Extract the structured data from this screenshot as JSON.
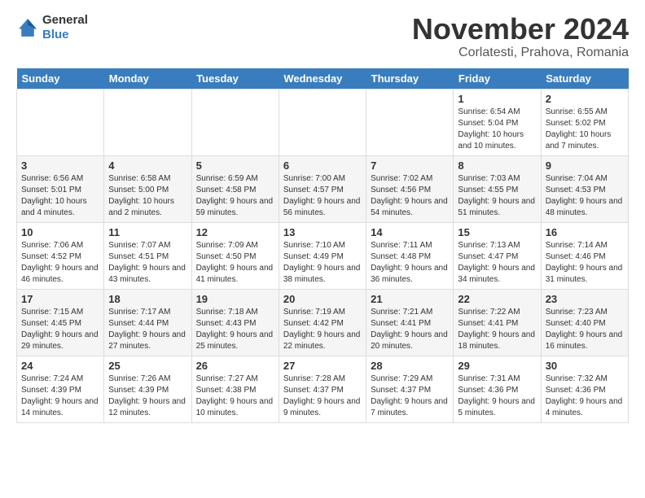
{
  "header": {
    "logo_general": "General",
    "logo_blue": "Blue",
    "title": "November 2024",
    "location": "Corlatesti, Prahova, Romania"
  },
  "days_of_week": [
    "Sunday",
    "Monday",
    "Tuesday",
    "Wednesday",
    "Thursday",
    "Friday",
    "Saturday"
  ],
  "weeks": [
    [
      null,
      null,
      null,
      null,
      null,
      {
        "day": "1",
        "info": "Sunrise: 6:54 AM\nSunset: 5:04 PM\nDaylight: 10 hours and 10 minutes."
      },
      {
        "day": "2",
        "info": "Sunrise: 6:55 AM\nSunset: 5:02 PM\nDaylight: 10 hours and 7 minutes."
      }
    ],
    [
      {
        "day": "3",
        "info": "Sunrise: 6:56 AM\nSunset: 5:01 PM\nDaylight: 10 hours and 4 minutes."
      },
      {
        "day": "4",
        "info": "Sunrise: 6:58 AM\nSunset: 5:00 PM\nDaylight: 10 hours and 2 minutes."
      },
      {
        "day": "5",
        "info": "Sunrise: 6:59 AM\nSunset: 4:58 PM\nDaylight: 9 hours and 59 minutes."
      },
      {
        "day": "6",
        "info": "Sunrise: 7:00 AM\nSunset: 4:57 PM\nDaylight: 9 hours and 56 minutes."
      },
      {
        "day": "7",
        "info": "Sunrise: 7:02 AM\nSunset: 4:56 PM\nDaylight: 9 hours and 54 minutes."
      },
      {
        "day": "8",
        "info": "Sunrise: 7:03 AM\nSunset: 4:55 PM\nDaylight: 9 hours and 51 minutes."
      },
      {
        "day": "9",
        "info": "Sunrise: 7:04 AM\nSunset: 4:53 PM\nDaylight: 9 hours and 48 minutes."
      }
    ],
    [
      {
        "day": "10",
        "info": "Sunrise: 7:06 AM\nSunset: 4:52 PM\nDaylight: 9 hours and 46 minutes."
      },
      {
        "day": "11",
        "info": "Sunrise: 7:07 AM\nSunset: 4:51 PM\nDaylight: 9 hours and 43 minutes."
      },
      {
        "day": "12",
        "info": "Sunrise: 7:09 AM\nSunset: 4:50 PM\nDaylight: 9 hours and 41 minutes."
      },
      {
        "day": "13",
        "info": "Sunrise: 7:10 AM\nSunset: 4:49 PM\nDaylight: 9 hours and 38 minutes."
      },
      {
        "day": "14",
        "info": "Sunrise: 7:11 AM\nSunset: 4:48 PM\nDaylight: 9 hours and 36 minutes."
      },
      {
        "day": "15",
        "info": "Sunrise: 7:13 AM\nSunset: 4:47 PM\nDaylight: 9 hours and 34 minutes."
      },
      {
        "day": "16",
        "info": "Sunrise: 7:14 AM\nSunset: 4:46 PM\nDaylight: 9 hours and 31 minutes."
      }
    ],
    [
      {
        "day": "17",
        "info": "Sunrise: 7:15 AM\nSunset: 4:45 PM\nDaylight: 9 hours and 29 minutes."
      },
      {
        "day": "18",
        "info": "Sunrise: 7:17 AM\nSunset: 4:44 PM\nDaylight: 9 hours and 27 minutes."
      },
      {
        "day": "19",
        "info": "Sunrise: 7:18 AM\nSunset: 4:43 PM\nDaylight: 9 hours and 25 minutes."
      },
      {
        "day": "20",
        "info": "Sunrise: 7:19 AM\nSunset: 4:42 PM\nDaylight: 9 hours and 22 minutes."
      },
      {
        "day": "21",
        "info": "Sunrise: 7:21 AM\nSunset: 4:41 PM\nDaylight: 9 hours and 20 minutes."
      },
      {
        "day": "22",
        "info": "Sunrise: 7:22 AM\nSunset: 4:41 PM\nDaylight: 9 hours and 18 minutes."
      },
      {
        "day": "23",
        "info": "Sunrise: 7:23 AM\nSunset: 4:40 PM\nDaylight: 9 hours and 16 minutes."
      }
    ],
    [
      {
        "day": "24",
        "info": "Sunrise: 7:24 AM\nSunset: 4:39 PM\nDaylight: 9 hours and 14 minutes."
      },
      {
        "day": "25",
        "info": "Sunrise: 7:26 AM\nSunset: 4:39 PM\nDaylight: 9 hours and 12 minutes."
      },
      {
        "day": "26",
        "info": "Sunrise: 7:27 AM\nSunset: 4:38 PM\nDaylight: 9 hours and 10 minutes."
      },
      {
        "day": "27",
        "info": "Sunrise: 7:28 AM\nSunset: 4:37 PM\nDaylight: 9 hours and 9 minutes."
      },
      {
        "day": "28",
        "info": "Sunrise: 7:29 AM\nSunset: 4:37 PM\nDaylight: 9 hours and 7 minutes."
      },
      {
        "day": "29",
        "info": "Sunrise: 7:31 AM\nSunset: 4:36 PM\nDaylight: 9 hours and 5 minutes."
      },
      {
        "day": "30",
        "info": "Sunrise: 7:32 AM\nSunset: 4:36 PM\nDaylight: 9 hours and 4 minutes."
      }
    ]
  ]
}
